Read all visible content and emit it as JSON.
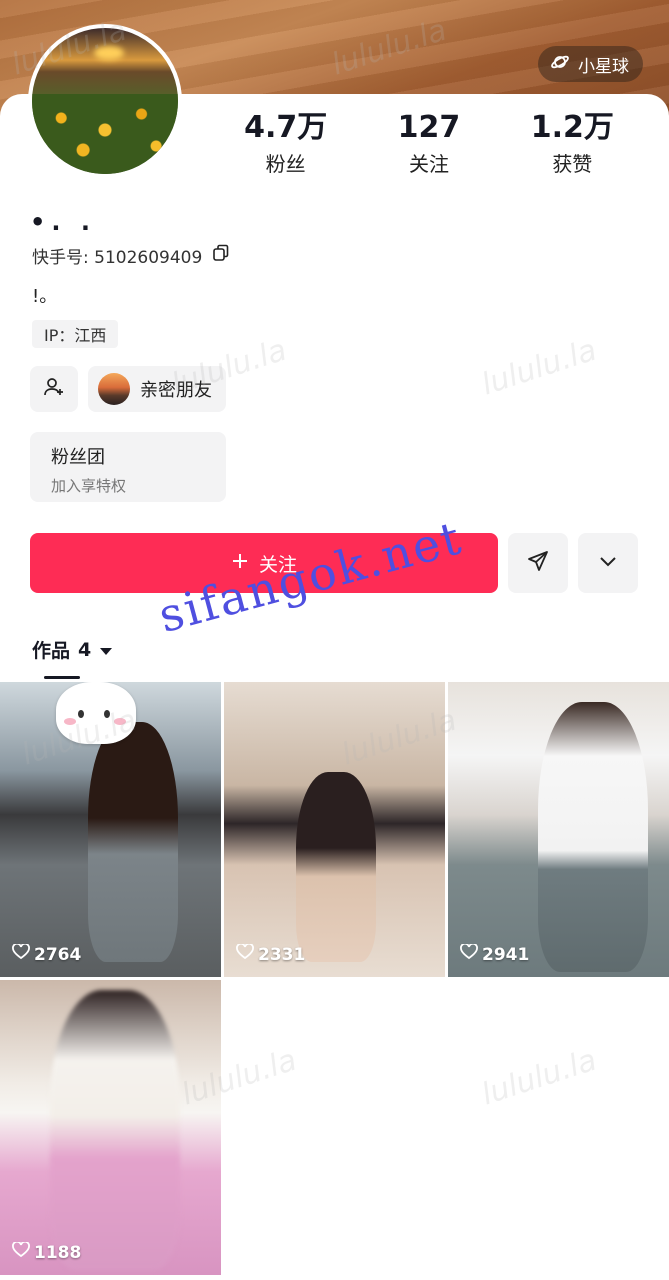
{
  "header": {
    "planet_label": "小星球"
  },
  "profile": {
    "nickname": "•. .",
    "kid_label": "快手号: 5102609409",
    "bio": "!。",
    "ip_label": "IP：江西"
  },
  "stats": [
    {
      "value": "4.7万",
      "label": "粉丝"
    },
    {
      "value": "127",
      "label": "关注"
    },
    {
      "value": "1.2万",
      "label": "获赞"
    }
  ],
  "actions": {
    "close_friend_label": "亲密朋友",
    "fan_club_title": "粉丝团",
    "fan_club_sub": "加入享特权",
    "follow_label": "关注"
  },
  "tabs": {
    "works_label": "作品",
    "works_count": "4"
  },
  "videos": [
    {
      "likes": "2764"
    },
    {
      "likes": "2331"
    },
    {
      "likes": "2941"
    },
    {
      "likes": "1188"
    }
  ],
  "watermark": {
    "text": "sifangok.net",
    "faint_text": "lululu.la"
  },
  "colors": {
    "accent": "#fe2c55",
    "watermark": "#4f4fe0"
  }
}
